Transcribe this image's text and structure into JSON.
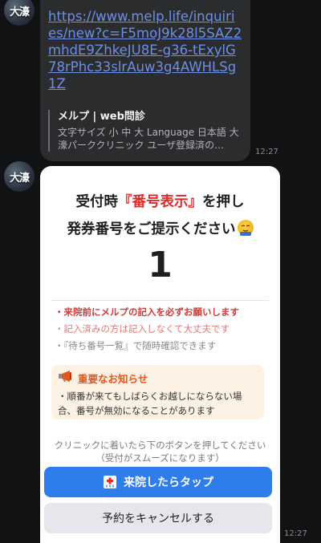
{
  "avatar": {
    "label": "大濠"
  },
  "message1": {
    "link": "https://www.melp.life/inquiries/new?c=F5moJ9k28l5SAZ2mhdE9ZhkeJU8E-g36-tExylG78rPhc33slrAuw3g4AWHLSg1Z",
    "preview_title": "メルプ | web問診",
    "preview_desc": "文字サイズ 小 中 大 Language 日本語 大濠パーククリニック ユーザ登録済の…",
    "timestamp": "12:27"
  },
  "card": {
    "title_prefix": "受付時",
    "title_highlight": "『番号表示』",
    "title_suffix": "を押し",
    "title_line2": "発券番号をご提示ください",
    "ticket_number": "1",
    "notes": [
      "・来院前にメルプの記入を必ずお願いします",
      "・記入済みの方は記入しなくて大丈夫です",
      "・『待ち番号一覧』で随時確認できます"
    ],
    "notice_title": "重要なお知らせ",
    "notice_body": "・順番が来てもしばらくお越しにならない場合、番号が無効になることがあります",
    "hint_line1": "クリニックに着いたら下のボタンを押してください",
    "hint_line2": "（受付がスムーズになります）",
    "arrive_button": "来院したらタップ",
    "cancel_button": "予約をキャンセルする",
    "timestamp": "12:27"
  },
  "colors": {
    "link": "#6d8fe8",
    "highlight": "#e02a2a",
    "primary_button": "#2f7dea",
    "notice_title": "#e0581f"
  },
  "icons": {
    "notice": "megaphone-icon",
    "arrive": "hospital-icon",
    "emoji": "bowing-face-emoji"
  }
}
